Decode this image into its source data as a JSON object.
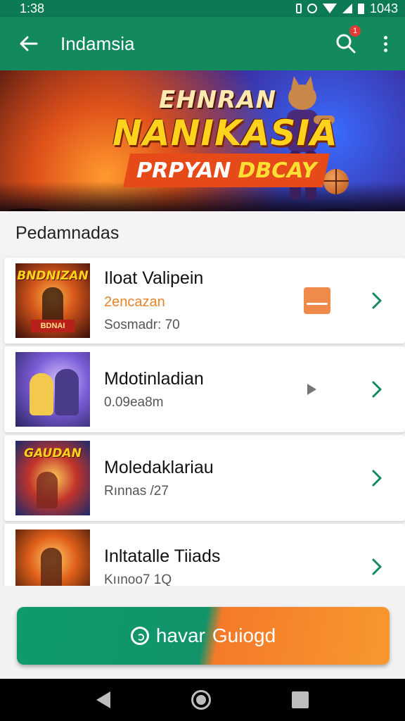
{
  "status_bar": {
    "time": "1:38",
    "battery": "1043"
  },
  "app_bar": {
    "title": "Indamsia",
    "notification_count": "1"
  },
  "banner": {
    "line1": "EHNRAN",
    "line2": "NANIKASIA",
    "line3": "PRPYAN",
    "line4": "DBCAY"
  },
  "section": {
    "title": "Pedamnadas"
  },
  "items": [
    {
      "title": "Iloat Valipein",
      "subtitle": "2encazan",
      "meta": "Sosmadr: 70",
      "thumb_title": "BNDNIZAN",
      "thumb_badge": "BDNAI",
      "trailing": "orange-badge-icon"
    },
    {
      "title": "Mdotinladian",
      "subtitle": "0.09ea8m",
      "thumb_title": "",
      "trailing": "play-icon"
    },
    {
      "title": "Moledaklariau",
      "subtitle": "Rınnas /27",
      "thumb_title": "GAUDAN",
      "trailing": "none"
    },
    {
      "title": "Inltatalle Tiiads",
      "subtitle": "Kıınoo7 1Q",
      "thumb_title": "",
      "trailing": "none"
    }
  ],
  "cta": {
    "label_green": "havar",
    "label_orange": "Guiogd",
    "icon": "circle-icon"
  },
  "colors": {
    "primary": "#138a5e",
    "accent": "#f47a2a",
    "chevron": "#138a5e"
  }
}
